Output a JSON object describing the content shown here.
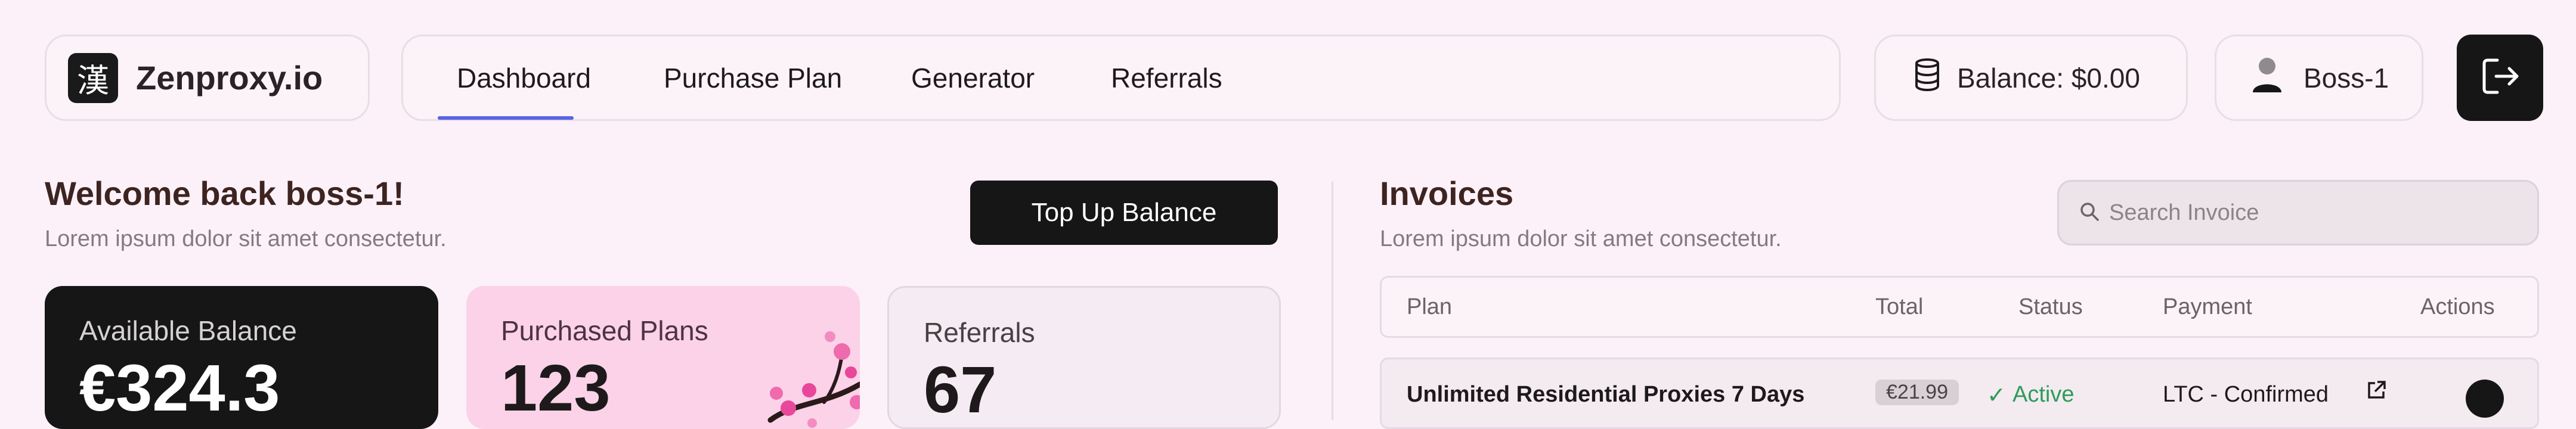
{
  "brand": {
    "logo_glyph": "漢",
    "name": "Zenproxy.io"
  },
  "nav": {
    "tabs": [
      {
        "label": "Dashboard",
        "active": true
      },
      {
        "label": "Purchase Plan",
        "active": false
      },
      {
        "label": "Generator",
        "active": false
      },
      {
        "label": "Referrals",
        "active": false
      }
    ],
    "active_color": "#5b63e6"
  },
  "header": {
    "balance_label": "Balance: $0.00",
    "username": "Boss-1",
    "icons": [
      "database-icon",
      "user-icon",
      "logout-icon"
    ]
  },
  "welcome": {
    "title": "Welcome back boss-1!",
    "subtitle": "Lorem ipsum dolor sit amet consectetur.",
    "topup_label": "Top Up Balance"
  },
  "stats": [
    {
      "label": "Available Balance",
      "value": "€324.3"
    },
    {
      "label": "Purchased Plans",
      "value": "123"
    },
    {
      "label": "Referrals",
      "value": "67"
    }
  ],
  "invoices": {
    "title": "Invoices",
    "subtitle": "Lorem ipsum dolor sit amet consectetur.",
    "search_placeholder": "Search Invoice",
    "columns": [
      "Plan",
      "Total",
      "Status",
      "Payment",
      "Actions"
    ],
    "rows": [
      {
        "plan": "Unlimited Residential Proxies 7 Days",
        "total": "€21.99",
        "status": "Active",
        "payment": "LTC - Confirmed"
      }
    ]
  },
  "colors": {
    "background": "#fcf1f8",
    "dark": "#161616",
    "pink_card": "#fbd2e8",
    "status_green": "#2e9b5c"
  }
}
